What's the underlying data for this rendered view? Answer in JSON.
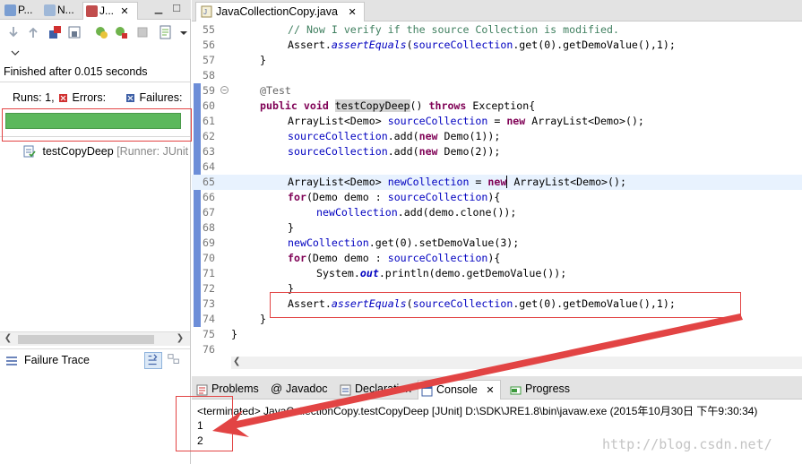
{
  "left_panel": {
    "tabs": [
      {
        "label": "P..."
      },
      {
        "label": "N..."
      },
      {
        "label": "J..."
      }
    ],
    "status": "Finished after 0.015 seconds",
    "counters": {
      "runs_label": "Runs:",
      "runs_value": "1,",
      "errors_label": "Errors:",
      "failures_label": "Failures:"
    },
    "progress_color": "#5cb85c",
    "test_item": {
      "name": "testCopyDeep",
      "runner": "[Runner: JUnit"
    },
    "failure_trace_label": "Failure Trace"
  },
  "editor": {
    "tab_title": "JavaCollectionCopy.java",
    "lines": [
      {
        "n": "55"
      },
      {
        "n": "56"
      },
      {
        "n": "57"
      },
      {
        "n": "58"
      },
      {
        "n": "59"
      },
      {
        "n": "60"
      },
      {
        "n": "61"
      },
      {
        "n": "62"
      },
      {
        "n": "63"
      },
      {
        "n": "64"
      },
      {
        "n": "65"
      },
      {
        "n": "66"
      },
      {
        "n": "67"
      },
      {
        "n": "68"
      },
      {
        "n": "69"
      },
      {
        "n": "70"
      },
      {
        "n": "71"
      },
      {
        "n": "72"
      },
      {
        "n": "73"
      },
      {
        "n": "74"
      },
      {
        "n": "75"
      },
      {
        "n": "76"
      }
    ],
    "code": {
      "l55": "// Now I verify if the source Collection is modified.",
      "l56_a": "Assert.",
      "l56_m": "assertEquals",
      "l56_b": "(",
      "l56_f": "sourceCollection",
      "l56_c": ".get(0).getDemoValue(),1);",
      "l57": "}",
      "l59": "@Test",
      "l60_k1": "public",
      "l60_k2": "void",
      "l60_m": "testCopyDeep",
      "l60_b": "()",
      "l60_k3": "throws",
      "l60_c": "Exception{",
      "l61_a": "ArrayList<Demo>",
      "l61_f": "sourceCollection",
      "l61_b": " = ",
      "l61_k": "new",
      "l61_c": "ArrayList<Demo>();",
      "l62_f": "sourceCollection",
      "l62_a": ".add(",
      "l62_k": "new",
      "l62_b": "Demo(1));",
      "l63_f": "sourceCollection",
      "l63_a": ".add(",
      "l63_k": "new",
      "l63_b": "Demo(2));",
      "l65_a": "ArrayList<Demo>",
      "l65_f": "newCollection",
      "l65_b": " = ",
      "l65_k": "new",
      "l65_c": "ArrayList<Demo>();",
      "l66_k": "for",
      "l66_a": "(Demo",
      "l66_f": "demo",
      "l66_b": " : ",
      "l66_f2": "sourceCollection",
      "l66_c": "){",
      "l67_f": "newCollection",
      "l67_a": ".add(",
      "l67_f2": "demo",
      "l67_b": ".clone());",
      "l68": "}",
      "l69_f": "newCollection",
      "l69_a": ".get(0).setDemoValue(3);",
      "l70_k": "for",
      "l70_a": "(Demo",
      "l70_f": "demo",
      "l70_b": " : ",
      "l70_f2": "sourceCollection",
      "l70_c": "){",
      "l71_a": "System.",
      "l71_s": "out",
      "l71_b": ".println(",
      "l71_f": "demo",
      "l71_c": ".getDemoValue());",
      "l72": "}",
      "l73_a": "Assert.",
      "l73_m": "assertEquals",
      "l73_b": "(",
      "l73_f": "sourceCollection",
      "l73_c": ".get(0).getDemoValue(),1);",
      "l74": "}",
      "l75": "}"
    }
  },
  "console": {
    "tabs": [
      {
        "label": "Problems"
      },
      {
        "label": "Javadoc"
      },
      {
        "label": "Declaration"
      },
      {
        "label": "Console"
      },
      {
        "label": "Progress"
      }
    ],
    "terminated": "<terminated> JavaCollectionCopy.testCopyDeep [JUnit] D:\\SDK\\JRE1.8\\bin\\javaw.exe (2015年10月30日 下午9:30:34)",
    "output": [
      "1",
      "2"
    ]
  },
  "watermark": "http://blog.csdn.net/",
  "colors": {
    "annotation_red": "#e24444",
    "keyword": "#7f0055",
    "comment": "#3f7f5f",
    "field": "#0000c0"
  }
}
